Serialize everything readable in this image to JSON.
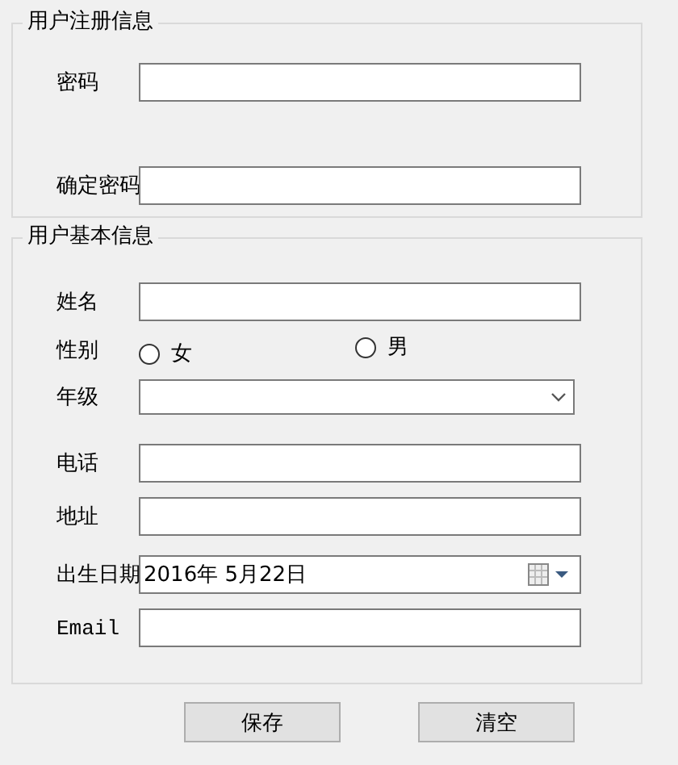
{
  "groups": [
    {
      "title": "用户注册信息",
      "fields": [
        {
          "kind": "text",
          "label": "密码"
        },
        {
          "kind": "text",
          "label": "确定密码"
        }
      ]
    },
    {
      "title": "用户基本信息",
      "fields": [
        {
          "kind": "text",
          "label": "姓名"
        },
        {
          "kind": "radio",
          "label": "性别",
          "options": [
            {
              "label": "女",
              "selected": false
            },
            {
              "label": "男",
              "selected": false
            }
          ]
        },
        {
          "kind": "select",
          "label": "年级"
        },
        {
          "kind": "text",
          "label": "电话"
        },
        {
          "kind": "text",
          "label": "地址"
        },
        {
          "kind": "date",
          "label": "出生日期",
          "value": "2016年 5月22日"
        },
        {
          "kind": "text",
          "label": "Email"
        }
      ]
    }
  ],
  "buttons": [
    "保存",
    "清空"
  ]
}
